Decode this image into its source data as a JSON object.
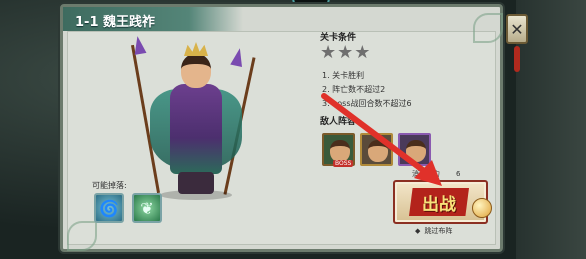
{
  "title": "1-1 魏王践祚",
  "conditions": {
    "heading": "关卡条件",
    "stars": "★★★",
    "items": [
      "1. 关卡胜利",
      "2. 阵亡数不超过2",
      "3. boss战回合数不超过6"
    ]
  },
  "enemy": {
    "heading": "敌人阵容",
    "boss_badge": "BOSS"
  },
  "drops": {
    "label": "可能掉落:",
    "items": [
      {
        "icon": "blue-swirl-icon",
        "glyph": "🌀"
      },
      {
        "icon": "green-leaf-icon",
        "glyph": "❦"
      }
    ]
  },
  "stamina": {
    "label": "消耗体力",
    "value": "6"
  },
  "fight_button": {
    "label": "出战"
  },
  "skip": {
    "label": "跳过布阵"
  },
  "close": {
    "glyph": "✕"
  },
  "colors": {
    "accent": "#b3231b",
    "title_bar": "#3e6b5f",
    "panel": "#d4d8d1"
  }
}
